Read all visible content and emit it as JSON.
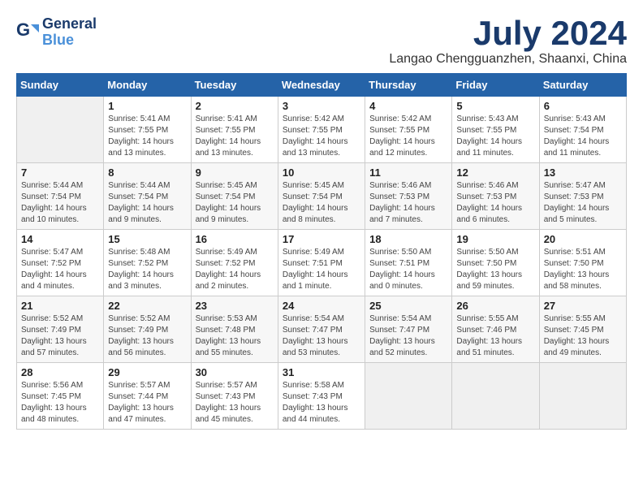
{
  "header": {
    "logo_line1": "General",
    "logo_line2": "Blue",
    "month": "July 2024",
    "location": "Langao Chengguanzhen, Shaanxi, China"
  },
  "days_of_week": [
    "Sunday",
    "Monday",
    "Tuesday",
    "Wednesday",
    "Thursday",
    "Friday",
    "Saturday"
  ],
  "weeks": [
    [
      {
        "day": "",
        "info": ""
      },
      {
        "day": "1",
        "info": "Sunrise: 5:41 AM\nSunset: 7:55 PM\nDaylight: 14 hours\nand 13 minutes."
      },
      {
        "day": "2",
        "info": "Sunrise: 5:41 AM\nSunset: 7:55 PM\nDaylight: 14 hours\nand 13 minutes."
      },
      {
        "day": "3",
        "info": "Sunrise: 5:42 AM\nSunset: 7:55 PM\nDaylight: 14 hours\nand 13 minutes."
      },
      {
        "day": "4",
        "info": "Sunrise: 5:42 AM\nSunset: 7:55 PM\nDaylight: 14 hours\nand 12 minutes."
      },
      {
        "day": "5",
        "info": "Sunrise: 5:43 AM\nSunset: 7:55 PM\nDaylight: 14 hours\nand 11 minutes."
      },
      {
        "day": "6",
        "info": "Sunrise: 5:43 AM\nSunset: 7:54 PM\nDaylight: 14 hours\nand 11 minutes."
      }
    ],
    [
      {
        "day": "7",
        "info": "Sunrise: 5:44 AM\nSunset: 7:54 PM\nDaylight: 14 hours\nand 10 minutes."
      },
      {
        "day": "8",
        "info": "Sunrise: 5:44 AM\nSunset: 7:54 PM\nDaylight: 14 hours\nand 9 minutes."
      },
      {
        "day": "9",
        "info": "Sunrise: 5:45 AM\nSunset: 7:54 PM\nDaylight: 14 hours\nand 9 minutes."
      },
      {
        "day": "10",
        "info": "Sunrise: 5:45 AM\nSunset: 7:54 PM\nDaylight: 14 hours\nand 8 minutes."
      },
      {
        "day": "11",
        "info": "Sunrise: 5:46 AM\nSunset: 7:53 PM\nDaylight: 14 hours\nand 7 minutes."
      },
      {
        "day": "12",
        "info": "Sunrise: 5:46 AM\nSunset: 7:53 PM\nDaylight: 14 hours\nand 6 minutes."
      },
      {
        "day": "13",
        "info": "Sunrise: 5:47 AM\nSunset: 7:53 PM\nDaylight: 14 hours\nand 5 minutes."
      }
    ],
    [
      {
        "day": "14",
        "info": "Sunrise: 5:47 AM\nSunset: 7:52 PM\nDaylight: 14 hours\nand 4 minutes."
      },
      {
        "day": "15",
        "info": "Sunrise: 5:48 AM\nSunset: 7:52 PM\nDaylight: 14 hours\nand 3 minutes."
      },
      {
        "day": "16",
        "info": "Sunrise: 5:49 AM\nSunset: 7:52 PM\nDaylight: 14 hours\nand 2 minutes."
      },
      {
        "day": "17",
        "info": "Sunrise: 5:49 AM\nSunset: 7:51 PM\nDaylight: 14 hours\nand 1 minute."
      },
      {
        "day": "18",
        "info": "Sunrise: 5:50 AM\nSunset: 7:51 PM\nDaylight: 14 hours\nand 0 minutes."
      },
      {
        "day": "19",
        "info": "Sunrise: 5:50 AM\nSunset: 7:50 PM\nDaylight: 13 hours\nand 59 minutes."
      },
      {
        "day": "20",
        "info": "Sunrise: 5:51 AM\nSunset: 7:50 PM\nDaylight: 13 hours\nand 58 minutes."
      }
    ],
    [
      {
        "day": "21",
        "info": "Sunrise: 5:52 AM\nSunset: 7:49 PM\nDaylight: 13 hours\nand 57 minutes."
      },
      {
        "day": "22",
        "info": "Sunrise: 5:52 AM\nSunset: 7:49 PM\nDaylight: 13 hours\nand 56 minutes."
      },
      {
        "day": "23",
        "info": "Sunrise: 5:53 AM\nSunset: 7:48 PM\nDaylight: 13 hours\nand 55 minutes."
      },
      {
        "day": "24",
        "info": "Sunrise: 5:54 AM\nSunset: 7:47 PM\nDaylight: 13 hours\nand 53 minutes."
      },
      {
        "day": "25",
        "info": "Sunrise: 5:54 AM\nSunset: 7:47 PM\nDaylight: 13 hours\nand 52 minutes."
      },
      {
        "day": "26",
        "info": "Sunrise: 5:55 AM\nSunset: 7:46 PM\nDaylight: 13 hours\nand 51 minutes."
      },
      {
        "day": "27",
        "info": "Sunrise: 5:55 AM\nSunset: 7:45 PM\nDaylight: 13 hours\nand 49 minutes."
      }
    ],
    [
      {
        "day": "28",
        "info": "Sunrise: 5:56 AM\nSunset: 7:45 PM\nDaylight: 13 hours\nand 48 minutes."
      },
      {
        "day": "29",
        "info": "Sunrise: 5:57 AM\nSunset: 7:44 PM\nDaylight: 13 hours\nand 47 minutes."
      },
      {
        "day": "30",
        "info": "Sunrise: 5:57 AM\nSunset: 7:43 PM\nDaylight: 13 hours\nand 45 minutes."
      },
      {
        "day": "31",
        "info": "Sunrise: 5:58 AM\nSunset: 7:43 PM\nDaylight: 13 hours\nand 44 minutes."
      },
      {
        "day": "",
        "info": ""
      },
      {
        "day": "",
        "info": ""
      },
      {
        "day": "",
        "info": ""
      }
    ]
  ]
}
